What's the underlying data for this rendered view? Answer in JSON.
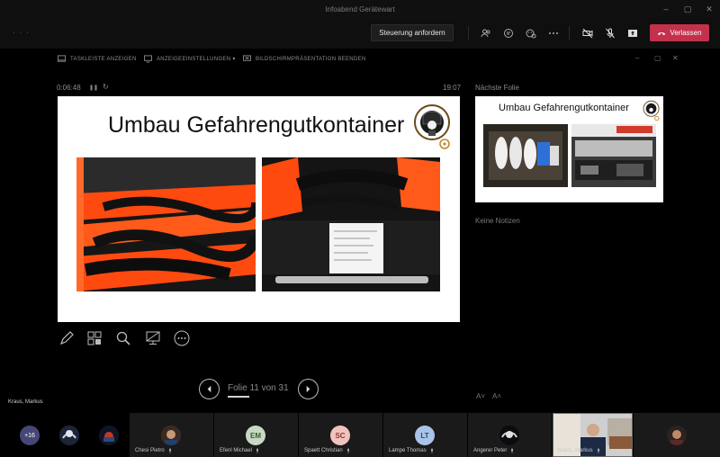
{
  "window": {
    "title": "Infoabend Gerätewart",
    "controls": [
      "–",
      "▢",
      "✕"
    ]
  },
  "meeting_toolbar": {
    "request_control_label": "Steuerung anfordern",
    "leave_label": "Verlassen",
    "icons": [
      "people-icon",
      "chat-icon",
      "reactions-icon",
      "more-icon",
      "camera-off-icon",
      "mic-off-icon",
      "share-icon"
    ],
    "colors": {
      "leave": "#c4314b",
      "toolbar": "#0f0f0f"
    }
  },
  "presenter_toolbar": {
    "taskbar_label": "TASKLEISTE ANZEIGEN",
    "display_settings_label": "ANZEIGEEINSTELLUNGEN ▾",
    "end_presentation_label": "BILDSCHIRMPRÄSENTATION BEENDEN",
    "window_controls": [
      "–",
      "▢",
      "✕"
    ]
  },
  "presentation": {
    "elapsed_time": "0:06:48",
    "pause_symbol": "❚❚",
    "restart_symbol": "↻",
    "clock": "19:07",
    "next_slide_label": "Nächste Folie",
    "notes_text": "Keine Notizen",
    "current_slide": {
      "title": "Umbau Gefahrengutkontainer",
      "logo_text": "FREIWILLIGE FEUERWEHR"
    },
    "next_slide": {
      "title": "Umbau Gefahrengutkontainer"
    },
    "slide_counter": "Folie 11 von 31",
    "font_decrease": "A˅",
    "font_increase": "A˄"
  },
  "active_speaker_label": "Kraus, Markus",
  "participants": {
    "overflow_badge": "+16",
    "tiles": [
      {
        "name": "Chesi Pietro",
        "initials": ""
      },
      {
        "name": "Efenl Michael",
        "initials": "EM",
        "color": "#c8d9c3"
      },
      {
        "name": "Spaett Christian",
        "initials": "SC",
        "color": "#f1c3bd"
      },
      {
        "name": "Lampe Thomas",
        "initials": "LT",
        "color": "#a9c4e8"
      },
      {
        "name": "Angerer Peter",
        "initials": ""
      },
      {
        "name": "Kraus, Markus",
        "initials": ""
      }
    ]
  }
}
